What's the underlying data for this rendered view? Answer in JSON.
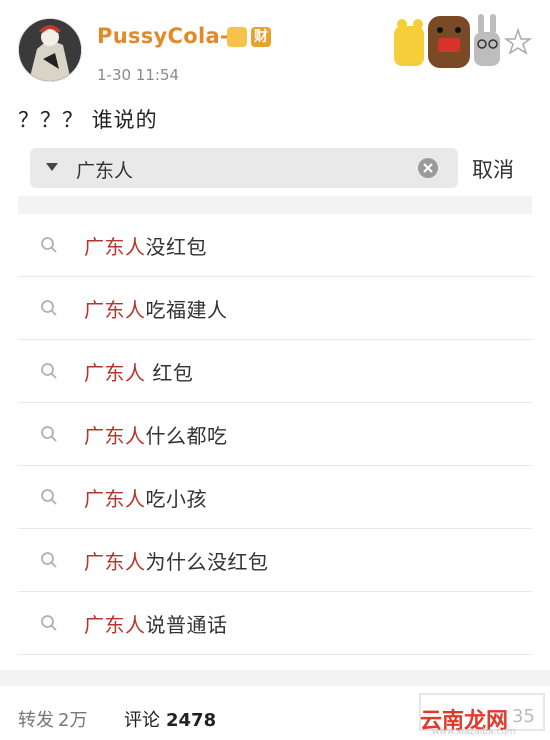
{
  "user": {
    "name": "PussyCola-",
    "badge_text": "财",
    "time": "1-30 11:54"
  },
  "post": {
    "text": "？？？ 谁说的"
  },
  "search": {
    "query": "广东人",
    "cancel_label": "取消"
  },
  "suggestions": [
    {
      "highlight": "广东人",
      "rest": "没红包"
    },
    {
      "highlight": "广东人",
      "rest": "吃福建人"
    },
    {
      "highlight": "广东人",
      "rest": " 红包"
    },
    {
      "highlight": "广东人",
      "rest": "什么都吃"
    },
    {
      "highlight": "广东人",
      "rest": "吃小孩"
    },
    {
      "highlight": "广东人",
      "rest": "为什么没红包"
    },
    {
      "highlight": "广东人",
      "rest": "说普通话"
    }
  ],
  "footer": {
    "repost_label": "转发",
    "repost_count": "2万",
    "comment_label": "评论",
    "comment_count": "2478",
    "like_count": "35"
  },
  "watermark": {
    "text": "云南龙网",
    "sub": "www.xiazaiba.com"
  },
  "colors": {
    "username": "#e2892c",
    "highlight": "#b4362d"
  }
}
